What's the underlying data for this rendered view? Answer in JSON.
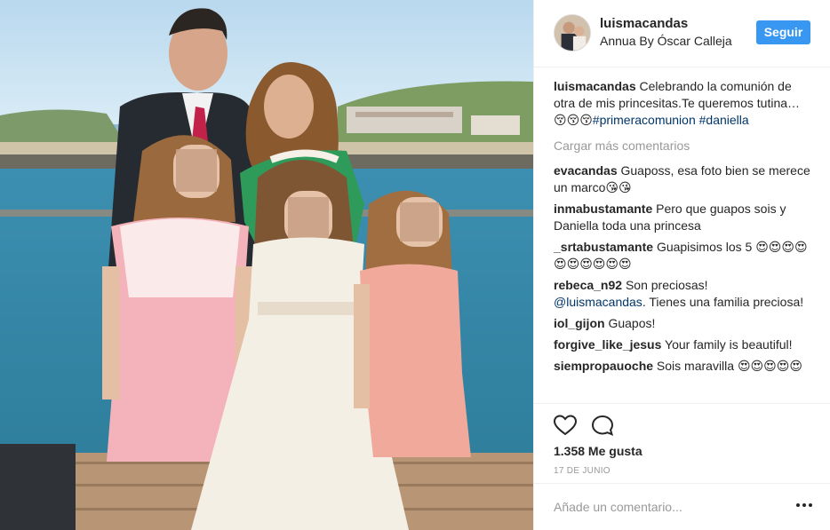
{
  "post": {
    "username": "luismacandas",
    "location": "Annua By Óscar Calleja",
    "follow_label": "Seguir"
  },
  "caption": {
    "user": "luismacandas",
    "text": "Celebrando la comunión de otra de mis princesitas.Te queremos tutina…😚😚😚",
    "tag1": "#primeracomunion",
    "tag2": "#daniella"
  },
  "load_more_label": "Cargar más comentarios",
  "comments": [
    {
      "user": "evacandas",
      "text": "Guaposs, esa foto bien se merece un marco😘😘"
    },
    {
      "user": "inmabustamante",
      "text": "Pero que guapos sois y Daniella toda una princesa"
    },
    {
      "user": "_srtabustamante",
      "text": "Guapisimos los 5 😍😍😍😍😍😍😍😍😍😍"
    },
    {
      "user": "rebeca_n92",
      "mention": "@luismacandas",
      "text": "Son preciosas!",
      "text2": ". Tienes una familia preciosa!"
    },
    {
      "user": "iol_gijon",
      "text": "Guapos!"
    },
    {
      "user": "forgive_like_jesus",
      "text": "Your family is beautiful!"
    },
    {
      "user": "siempropauoche",
      "text": "Sois maravilla 😍😍😍😍😍"
    }
  ],
  "actions": {
    "likes": "1.358 Me gusta",
    "date": "17 DE JUNIO"
  },
  "add_comment": {
    "placeholder": "Añade un comentario..."
  },
  "icons": {
    "like": "heart-icon",
    "comment": "speech-bubble-icon",
    "more": "more-options-icon"
  },
  "colors": {
    "follow_button": "#3897f0",
    "hashtag": "#003569",
    "muted": "#999999"
  }
}
